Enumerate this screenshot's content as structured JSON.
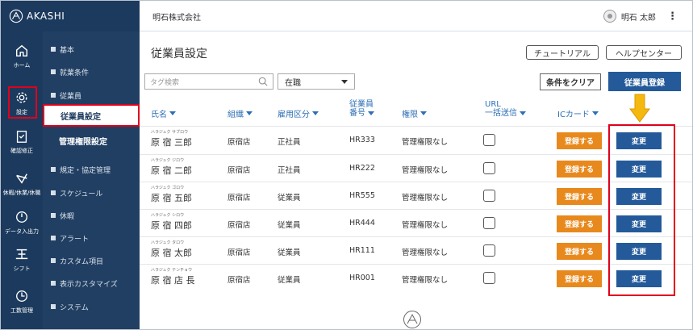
{
  "app": {
    "logo_text": "AKASHI",
    "company": "明石株式会社",
    "user_name": "明石 太郎",
    "kebab": "⋮"
  },
  "rail": [
    {
      "id": "home",
      "label": "ホーム",
      "icon": "home-icon"
    },
    {
      "id": "settings",
      "label": "設定",
      "icon": "gear-icon"
    },
    {
      "id": "attendance",
      "label": "確認修正",
      "icon": "clipboard-icon"
    },
    {
      "id": "leave",
      "label": "休暇/休業/休職",
      "icon": "checkmark-icon"
    },
    {
      "id": "data-io",
      "label": "データ入出力",
      "icon": "power-icon"
    },
    {
      "id": "shift",
      "label": "シフト",
      "icon": "shift-icon"
    },
    {
      "id": "work",
      "label": "工数管理",
      "icon": "clock-icon"
    }
  ],
  "submenu": {
    "items": [
      "基本",
      "就業条件",
      "従業員",
      "規定・協定管理",
      "スケジュール",
      "休暇",
      "アラート",
      "カスタム項目",
      "表示カスタマイズ",
      "システム"
    ],
    "children": [
      "従業員設定",
      "管理権限設定"
    ]
  },
  "page": {
    "title": "従業員設定",
    "tutorial_label": "チュートリアル",
    "help_label": "ヘルプセンター",
    "search_placeholder": "タグ検索",
    "status_value": "在職",
    "clear_label": "条件をクリア",
    "register_label": "従業員登録"
  },
  "table": {
    "headers": {
      "name": "氏名",
      "org": "組織",
      "employment": "雇用区分",
      "emp_no_1": "従業員",
      "emp_no_2": "番号",
      "role": "権限",
      "url_1": "URL",
      "url_2": "一括送信",
      "ic": "ICカード"
    },
    "register_btn": "登録する",
    "edit_btn": "変更",
    "rows": [
      {
        "kana": "ハラジュク サブロウ",
        "name": "原 宿 三郎",
        "org": "原宿店",
        "employment": "正社員",
        "emp_no": "HR333",
        "role": "管理権限なし"
      },
      {
        "kana": "ハラジュク ジロウ",
        "name": "原 宿 二郎",
        "org": "原宿店",
        "employment": "正社員",
        "emp_no": "HR222",
        "role": "管理権限なし"
      },
      {
        "kana": "ハラジュク ゴロウ",
        "name": "原 宿 五郎",
        "org": "原宿店",
        "employment": "従業員",
        "emp_no": "HR555",
        "role": "管理権限なし"
      },
      {
        "kana": "ハラジュク シロウ",
        "name": "原 宿 四郎",
        "org": "原宿店",
        "employment": "従業員",
        "emp_no": "HR444",
        "role": "管理権限なし"
      },
      {
        "kana": "ハラジュク タロウ",
        "name": "原 宿 太郎",
        "org": "原宿店",
        "employment": "従業員",
        "emp_no": "HR111",
        "role": "管理権限なし"
      },
      {
        "kana": "ハラジュク テンチョウ",
        "name": "原 宿 店 長",
        "org": "原宿店",
        "employment": "従業員",
        "emp_no": "HR001",
        "role": "管理権限なし"
      }
    ]
  },
  "colors": {
    "nav": "#1c3a5e",
    "accent": "#245a9a",
    "orange": "#e8891d",
    "highlight": "#e0001b",
    "arrow": "#f5b80f"
  }
}
